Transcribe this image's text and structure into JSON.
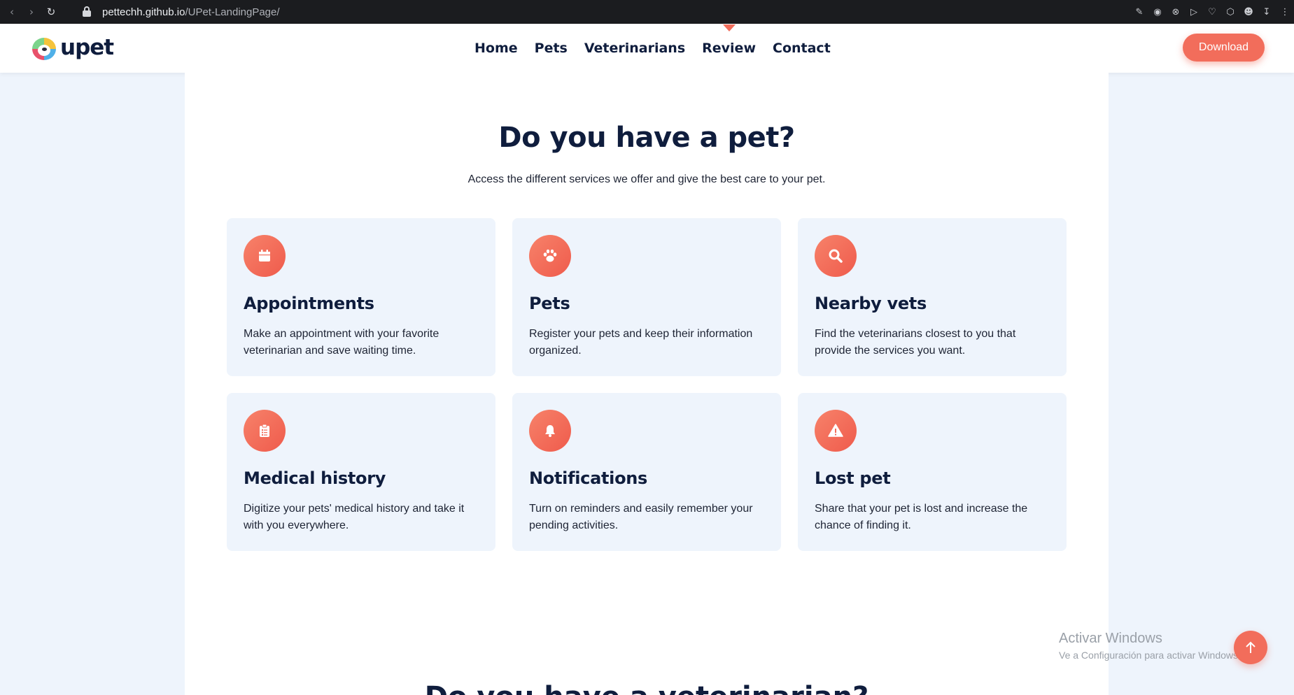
{
  "browser": {
    "url_host": "pettechh.github.io",
    "url_path": "/UPet-LandingPage/"
  },
  "header": {
    "logo_text": "upet",
    "nav": [
      {
        "label": "Home"
      },
      {
        "label": "Pets"
      },
      {
        "label": "Veterinarians"
      },
      {
        "label": "Review",
        "active": true
      },
      {
        "label": "Contact"
      }
    ],
    "download_label": "Download"
  },
  "services": {
    "title": "Do you have a pet?",
    "subtitle": "Access the different services we offer and give the best care to your pet.",
    "cards": [
      {
        "icon": "calendar-icon",
        "title": "Appointments",
        "text": "Make an appointment with your favorite veterinarian and save waiting time."
      },
      {
        "icon": "paw-icon",
        "title": "Pets",
        "text": "Register your pets and keep their information organized."
      },
      {
        "icon": "search-icon",
        "title": "Nearby vets",
        "text": "Find the veterinarians closest to you that provide the services you want."
      },
      {
        "icon": "clipboard-icon",
        "title": "Medical history",
        "text": "Digitize your pets' medical history and take it with you everywhere."
      },
      {
        "icon": "bell-icon",
        "title": "Notifications",
        "text": "Turn on reminders and easily remember your pending activities."
      },
      {
        "icon": "warning-icon",
        "title": "Lost pet",
        "text": "Share that your pet is lost and increase the chance of finding it."
      }
    ],
    "next_title": "Do you have a veterinarian?"
  },
  "watermark": {
    "title": "Activar Windows",
    "subtitle": "Ve a Configuración para activar Windows."
  },
  "colors": {
    "accent": "#f26d5b",
    "navy": "#0f1d3d",
    "card_bg": "#eef4fc"
  }
}
